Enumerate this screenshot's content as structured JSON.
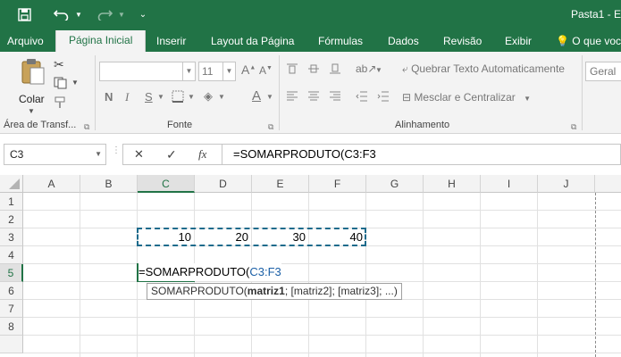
{
  "titlebar": {
    "doc_title": "Pasta1 - E",
    "icons": [
      "save-icon",
      "undo-icon",
      "redo-icon",
      "customize-qat-icon"
    ]
  },
  "tabs": [
    "Arquivo",
    "Página Inicial",
    "Inserir",
    "Layout da Página",
    "Fórmulas",
    "Dados",
    "Revisão",
    "Exibir",
    "O que você"
  ],
  "ribbon": {
    "clipboard": {
      "paste_label": "Colar",
      "group_label": "Área de Transf..."
    },
    "font": {
      "font_name": "",
      "font_size": "11",
      "bold": "N",
      "italic": "I",
      "underline": "S",
      "group_label": "Fonte"
    },
    "alignment": {
      "wrap_text": "Quebrar Texto Automaticamente",
      "merge_center": "Mesclar e Centralizar",
      "group_label": "Alinhamento"
    },
    "number": {
      "format": "Geral"
    }
  },
  "formula_bar": {
    "name_box": "C3",
    "cancel": "✕",
    "enter": "✓",
    "fx": "fx",
    "formula": "=SOMARPRODUTO(C3:F3"
  },
  "grid": {
    "columns": [
      "A",
      "B",
      "C",
      "D",
      "E",
      "F",
      "G",
      "H",
      "I",
      "J"
    ],
    "rows": [
      "1",
      "2",
      "3",
      "4",
      "5",
      "6",
      "7",
      "8"
    ],
    "selected_column": "C",
    "selected_row": "5",
    "row3_values": [
      "10",
      "20",
      "30",
      "40"
    ],
    "edit_prefix": "=SOMARPRODUTO(",
    "edit_ref": "C3:F3",
    "tooltip": {
      "func": "SOMARPRODUTO(",
      "arg1": "matriz1",
      "rest": "; [matriz2]; [matriz3]; ...)"
    }
  },
  "colors": {
    "excel_green": "#217346",
    "reference_blue": "#1a5fa6"
  }
}
